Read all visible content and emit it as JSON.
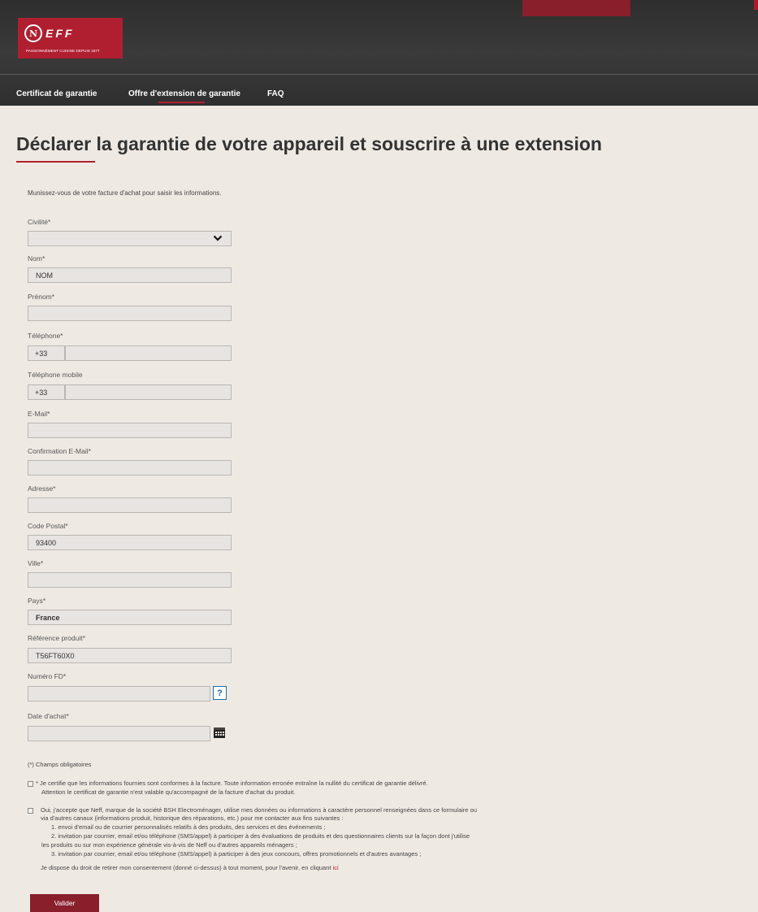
{
  "header": {
    "logo_mark": "N",
    "logo_name": "EFF",
    "logo_tagline": "PASSIONNÉMENT CUISINE DEPUIS 1877",
    "nav": [
      {
        "label": "Certificat de garantie"
      },
      {
        "label": "Offre d'extension de garantie",
        "active": true
      },
      {
        "label": "FAQ"
      }
    ]
  },
  "colors": {
    "brand_red": "#b01f30",
    "dark_red": "#8a1f2c",
    "link_blue": "#1b6ea8"
  },
  "page": {
    "title": "Déclarer la garantie de votre appareil et souscrire à une extension",
    "intro": "Munissez-vous de votre facture d'achat pour saisir les informations."
  },
  "form": {
    "civilite": {
      "label": "Civilité*",
      "value": ""
    },
    "nom": {
      "label": "Nom*",
      "value": "NOM"
    },
    "prenom": {
      "label": "Prénom*",
      "value": ""
    },
    "telephone": {
      "label": "Téléphone*",
      "prefix": "+33",
      "value": ""
    },
    "mobile": {
      "label": "Téléphone mobile",
      "prefix": "+33",
      "value": ""
    },
    "email": {
      "label": "E-Mail*",
      "value": ""
    },
    "email_confirm": {
      "label": "Confirmation E-Mail*",
      "value": ""
    },
    "adresse": {
      "label": "Adresse*",
      "value": ""
    },
    "code_postal": {
      "label": "Code Postal*",
      "value": "93400"
    },
    "ville": {
      "label": "Ville*",
      "value": ""
    },
    "pays": {
      "label": "Pays*",
      "value": "France"
    },
    "reference": {
      "label": "Référence produit*",
      "value": "T56FT60X0"
    },
    "numero_fd": {
      "label": "Numéro FD*",
      "value": "",
      "help": "?"
    },
    "date_achat": {
      "label": "Date d'achat*",
      "value": ""
    }
  },
  "legal": {
    "required_note": "(*) Champs obligatoires",
    "certify_line1": "* Je certifie que les informations fournies sont conformes à la facture. Toute information erronée entraîne la nullité du certificat de garantie délivré.",
    "certify_line2": "Attention le certificat de garantie n'est valable qu'accompagné de la facture d'achat du produit.",
    "consent_lines": [
      "Oui, j'accepte que Neff, marque de la société BSH Electroménager, utilise mes données ou informations à caractère personnel renseignées dans ce formulaire ou",
      "via d'autres canaux (informations produit, historique des réparations, etc.) pour me contacter aux fins suivantes :",
      "1. envoi d'email ou de courrier personnalisés relatifs à des produits, des services et des événements ;",
      "2. invitation par courrier, email et/ou téléphone (SMS/appel) à participer à des évaluations de produits et des questionnaires clients sur la façon dont j'utilise",
      "les produits ou sur mon expérience générale vis-à-vis de Neff ou d'autres appareils ménagers ;",
      "3. invitation par courrier, email et/ou téléphone (SMS/appel) à participer à des jeux concours, offres promotionnels et d'autres avantages ;"
    ],
    "withdraw_text": "Je dispose du droit de retirer mon consentement (donné ci-dessus) à tout moment, pour l'avenir, en cliquant",
    "withdraw_link": "ici"
  },
  "actions": {
    "submit_label": "Valider"
  }
}
